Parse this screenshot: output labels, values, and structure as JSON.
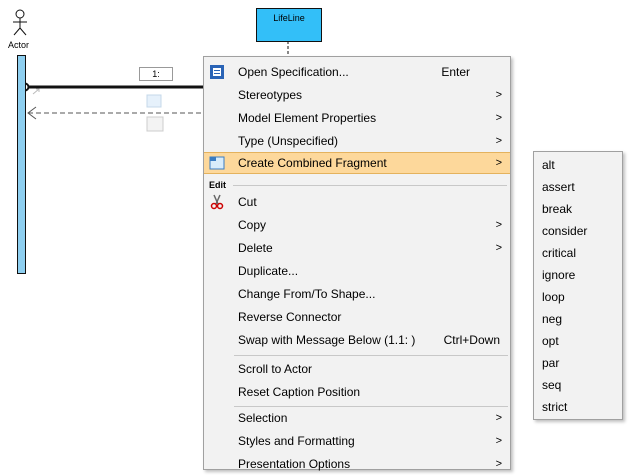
{
  "diagram": {
    "actor_label": "Actor",
    "lifeline_label": "LifeLine",
    "message_label": "1:"
  },
  "menu": {
    "items": [
      {
        "label": "Open Specification...",
        "shortcut": "Enter",
        "icon": "specification-icon"
      },
      {
        "label": "Stereotypes",
        "submenu": true
      },
      {
        "label": "Model Element Properties",
        "submenu": true
      },
      {
        "label": "Type (Unspecified)",
        "submenu": true
      },
      {
        "label": "Create Combined Fragment",
        "submenu": true,
        "highlighted": true,
        "icon": "combined-fragment-icon"
      },
      {
        "group": "Edit"
      },
      {
        "label": "Cut",
        "icon": "scissors-icon"
      },
      {
        "label": "Copy",
        "submenu": true
      },
      {
        "label": "Delete",
        "submenu": true
      },
      {
        "label": "Duplicate..."
      },
      {
        "label": "Change From/To Shape..."
      },
      {
        "label": "Reverse Connector"
      },
      {
        "label": "Swap with Message Below (1.1: )",
        "shortcut": "Ctrl+Down"
      },
      {
        "label": "Scroll to Actor"
      },
      {
        "label": "Reset Caption Position"
      },
      {
        "label": "Selection",
        "submenu": true
      },
      {
        "label": "Styles and Formatting",
        "submenu": true
      },
      {
        "label": "Presentation Options",
        "submenu": true
      }
    ],
    "arrow_glyph": ">"
  },
  "submenu": {
    "items": [
      "alt",
      "assert",
      "break",
      "consider",
      "critical",
      "ignore",
      "loop",
      "neg",
      "opt",
      "par",
      "seq",
      "strict"
    ]
  },
  "colors": {
    "highlight": "#fdd89b",
    "lifeline_fill": "#33bff8",
    "actor_bar_fill": "#8ecff0",
    "menu_bg": "#f2f2f2"
  }
}
